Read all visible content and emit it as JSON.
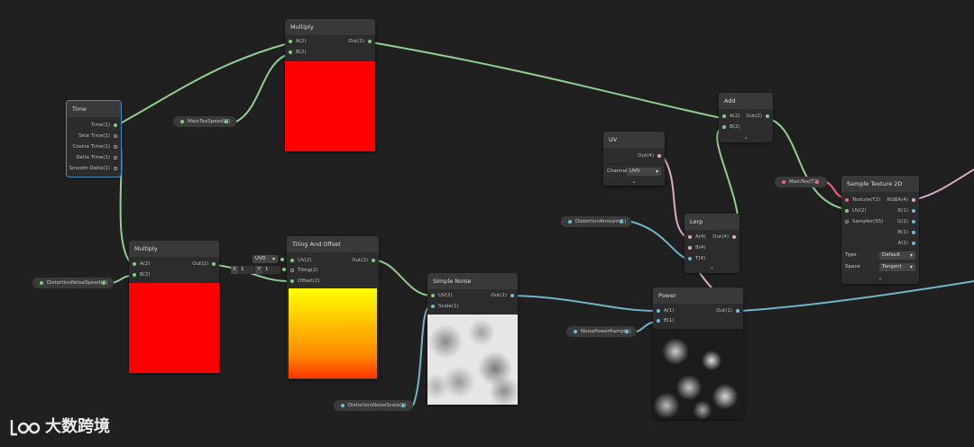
{
  "nodes": {
    "multiply_top": {
      "title": "Multiply",
      "in_a": "A(2)",
      "in_b": "B(2)",
      "out": "Out(2)"
    },
    "time": {
      "title": "Time",
      "outputs": [
        "Time(1)",
        "Sine Time(1)",
        "Cosine Time(1)",
        "Delta Time(1)",
        "Smooth Delta(1)"
      ]
    },
    "multiply_bottom": {
      "title": "Multiply",
      "in_a": "A(2)",
      "in_b": "B(2)",
      "out": "Out(2)"
    },
    "tiling_offset": {
      "title": "Tiling And Offset",
      "in_uv": "UV(2)",
      "in_tiling": "Tiling(2)",
      "in_offset": "Offset(2)",
      "out": "Out(2)",
      "uv_dropdown": "UV0",
      "tiling_x_label": "X",
      "tiling_x": "1",
      "tiling_y_label": "Y",
      "tiling_y": "1"
    },
    "simple_noise": {
      "title": "Simple Noise",
      "in_uv": "UV(2)",
      "in_scale": "Scale(1)",
      "out": "Out(1)"
    },
    "uv": {
      "title": "UV",
      "out": "Out(4)",
      "channel_label": "Channel",
      "channel_value": "UV0"
    },
    "lerp": {
      "title": "Lerp",
      "in_a": "A(4)",
      "in_b": "B(4)",
      "in_t": "T(4)",
      "out": "Out(4)"
    },
    "add": {
      "title": "Add",
      "in_a": "A(2)",
      "in_b": "B(2)",
      "out": "Out(2)"
    },
    "power": {
      "title": "Power",
      "in_a": "A(1)",
      "in_b": "B(1)",
      "out": "Out(1)"
    },
    "sample_texture": {
      "title": "Sample Texture 2D",
      "in_texture": "Texture(T2)",
      "in_uv": "UV(2)",
      "in_sampler": "Sampler(SS)",
      "outputs": [
        "RGBA(4)",
        "R(1)",
        "G(1)",
        "B(1)",
        "A(1)"
      ],
      "type_label": "Type",
      "type_value": "Default",
      "space_label": "Space",
      "space_value": "Tangent"
    }
  },
  "properties": {
    "main_tex_speed": "MainTexSpeed(2)",
    "distortion_noise_speed": "DistortionNoiseSpeed(2)",
    "distortion_noise_scale": "DistortionNoiseScale(1)",
    "noise_power_ramp": "NoisePowerRamp(1)",
    "distortion_amount": "DistortionAmount(1)",
    "main_tex": "MainTex(T2)"
  },
  "collapse_icon": "⌄",
  "watermark": {
    "text": "大数跨境"
  },
  "colors": {
    "background": "#202020",
    "node": "#2c2c2c",
    "wire_vector2": "#8fcf8f",
    "wire_vector4": "#d9aac8",
    "wire_vector1": "#6fb7c8",
    "preview_red": "#ff0000",
    "selection": "#4a8cc0"
  }
}
